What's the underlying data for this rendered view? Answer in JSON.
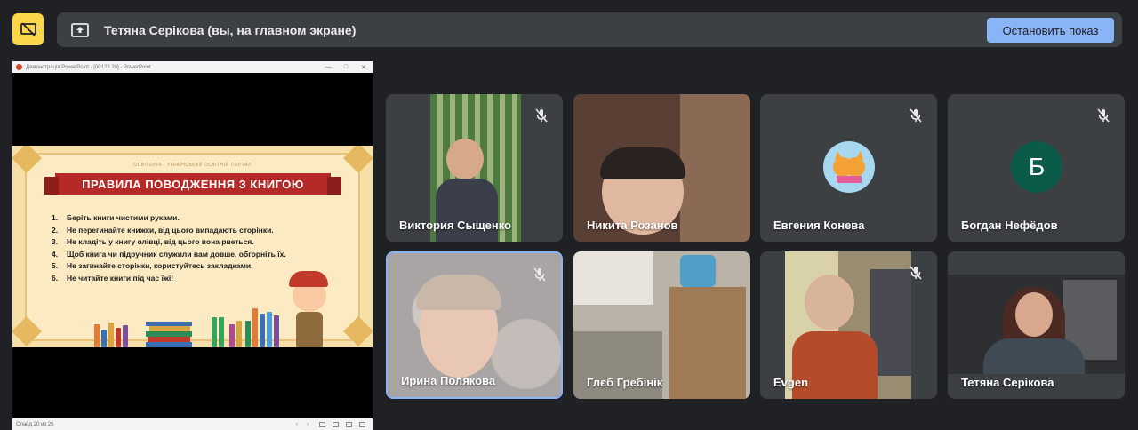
{
  "banner": {
    "presenter_text": "Тетяна Серікова (вы, на главном экране)",
    "stop_button": "Остановить показ"
  },
  "shared_window": {
    "title": "Демонстрація PowerPoint - [00123.20] - PowerPoint",
    "slide": {
      "site": "ОСВІТОРІЯ · УКРАЇНСЬКИЙ ОСВІТНІЙ ПОРТАЛ",
      "title": "ПРАВИЛА ПОВОДЖЕННЯ З КНИГОЮ",
      "rules": [
        {
          "num": "1.",
          "text": "Беріть книги чистими руками."
        },
        {
          "num": "2.",
          "text": "Не перегинайте книжки, від цього випадають сторінки."
        },
        {
          "num": "3.",
          "text": "Не кладіть у книгу олівці, від цього вона рветься."
        },
        {
          "num": "4.",
          "text": "Щоб книга чи підручник служили вам довше, обгорніть їх."
        },
        {
          "num": "5.",
          "text": "Не загинайте сторінки, користуйтесь закладками."
        },
        {
          "num": "6.",
          "text": "Не читайте книги під час їжі!"
        }
      ]
    },
    "status": "Слайд 20 из 26"
  },
  "participants": [
    {
      "name": "Виктория Сыщенко",
      "muted": true
    },
    {
      "name": "Никита Розанов",
      "muted": false
    },
    {
      "name": "Евгения Конева",
      "muted": true,
      "avatar": "cat-avatar"
    },
    {
      "name": "Богдан Нефёдов",
      "muted": true,
      "initial": "Б"
    },
    {
      "name": "Ирина Полякова",
      "muted": true,
      "active": true
    },
    {
      "name": "Глєб Гребінік",
      "muted": false
    },
    {
      "name": "Evgen",
      "muted": true
    },
    {
      "name": "Тетяна Серікова",
      "muted": false
    }
  ],
  "colors": {
    "background": "#202124",
    "tile": "#3c4043",
    "accent": "#8ab4f8",
    "presenting": "#fdd74a",
    "avatar_green": "#0b5b4b",
    "slide_ribbon": "#b52a26"
  },
  "icons": [
    "stop-presenting-icon",
    "present-screen-icon",
    "mic-off-icon"
  ]
}
